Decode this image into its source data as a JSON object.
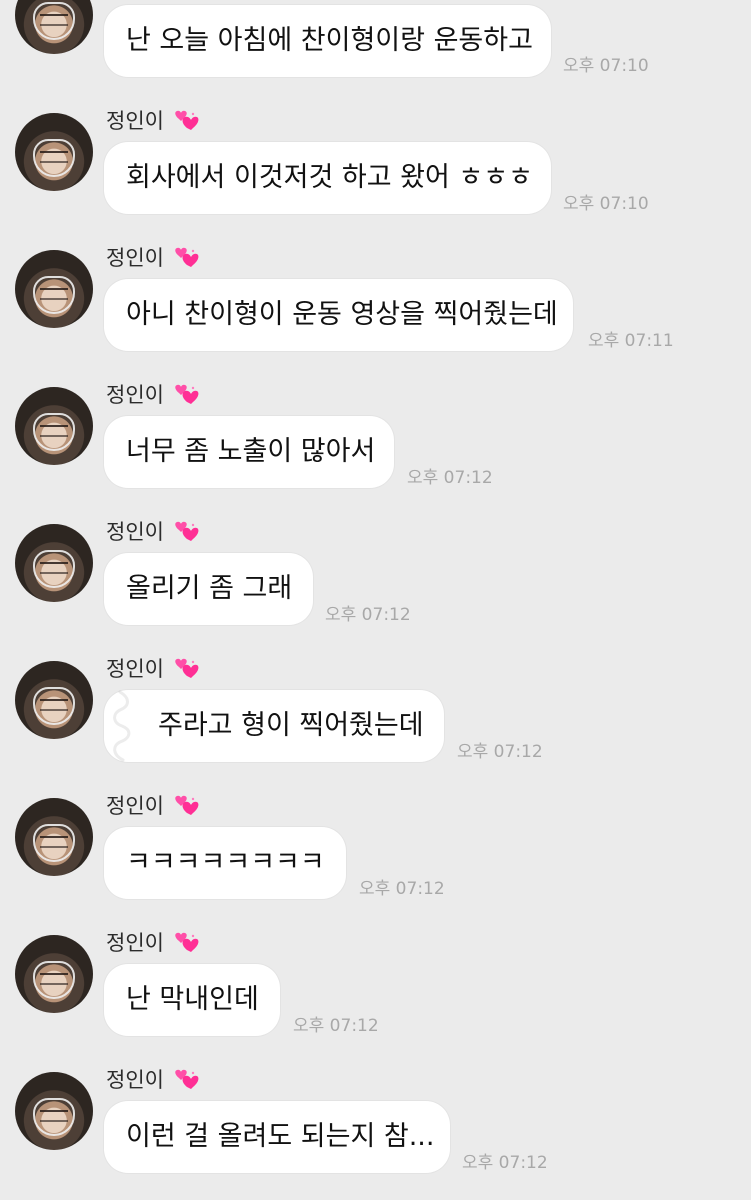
{
  "colors": {
    "background": "#ebebeb",
    "bubble": "#ffffff",
    "text": "#111111",
    "timestamp": "#a8a8a8"
  },
  "sender_name": "정인이",
  "heart_icon": "two-hearts-icon",
  "messages": [
    {
      "text": "난 오늘 아침에 찬이형이랑 운동하고",
      "time": "오후 07:10",
      "show_name": false
    },
    {
      "text": "회사에서 이것저것 하고 왔어 ㅎㅎㅎ",
      "time": "오후 07:10",
      "show_name": true
    },
    {
      "text": "아니 찬이형이 운동 영상을 찍어줬는데",
      "time": "오후 07:11",
      "show_name": true
    },
    {
      "text": "너무 좀 노출이 많아서",
      "time": "오후 07:12",
      "show_name": true
    },
    {
      "text": "올리기 좀 그래",
      "time": "오후 07:12",
      "show_name": true
    },
    {
      "text": "주라고 형이 찍어줬는데",
      "time": "오후 07:12",
      "show_name": true
    },
    {
      "text": "ㅋㅋㅋㅋㅋㅋㅋㅋ",
      "time": "오후 07:12",
      "show_name": true
    },
    {
      "text": "난 막내인데",
      "time": "오후 07:12",
      "show_name": true
    },
    {
      "text": "이런 걸 올려도 되는지 참...",
      "time": "오후 07:12",
      "show_name": true
    }
  ]
}
